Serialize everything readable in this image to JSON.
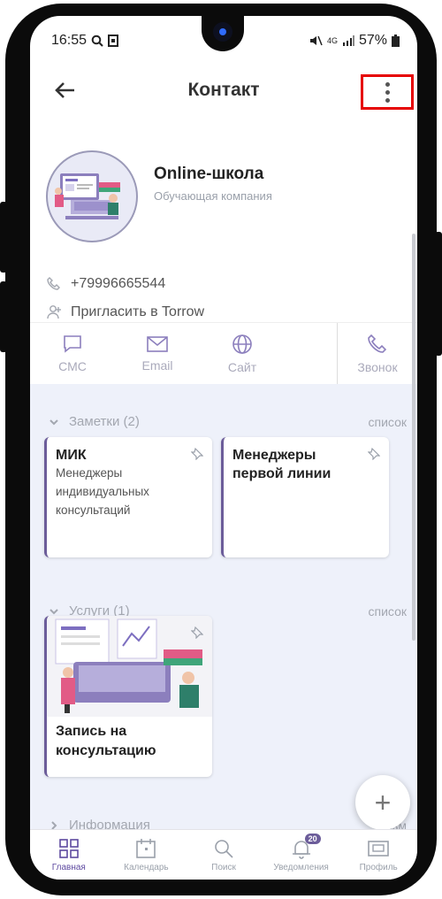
{
  "status_bar": {
    "time": "16:55",
    "network": "4G",
    "battery": "57%"
  },
  "header": {
    "title": "Контакт"
  },
  "profile": {
    "name": "Online-школа",
    "subtitle": "Обучающая компания"
  },
  "contact": {
    "phone": "+79996665544",
    "invite": "Пригласить в Torrow"
  },
  "actions": [
    {
      "label": "СМС",
      "icon": "chat-icon"
    },
    {
      "label": "Email",
      "icon": "mail-icon"
    },
    {
      "label": "Сайт",
      "icon": "globe-icon"
    },
    {
      "label": "Звонок",
      "icon": "phone-icon"
    }
  ],
  "notes": {
    "header": "Заметки (2)",
    "link": "список",
    "items": [
      {
        "title": "МИК",
        "desc": "Менеджеры индивидуальных консультаций"
      },
      {
        "title": "Менеджеры первой линии",
        "desc": ""
      }
    ]
  },
  "services": {
    "header": "Услуги (1)",
    "link": "список",
    "items": [
      {
        "title": "Запись на консультацию"
      }
    ]
  },
  "info": {
    "header": "Информация",
    "link": "Изм"
  },
  "tabs": [
    {
      "label": "Главная",
      "active": true,
      "icon": "grid-icon"
    },
    {
      "label": "Календарь",
      "icon": "calendar-icon"
    },
    {
      "label": "Поиск",
      "icon": "search-icon"
    },
    {
      "label": "Уведомления",
      "badge": "20",
      "icon": "bell-icon"
    },
    {
      "label": "Профиль",
      "icon": "profile-card-icon"
    }
  ],
  "colors": {
    "accent": "#6c5d9a",
    "highlight": "#e60000",
    "background": "#eef1fa"
  }
}
